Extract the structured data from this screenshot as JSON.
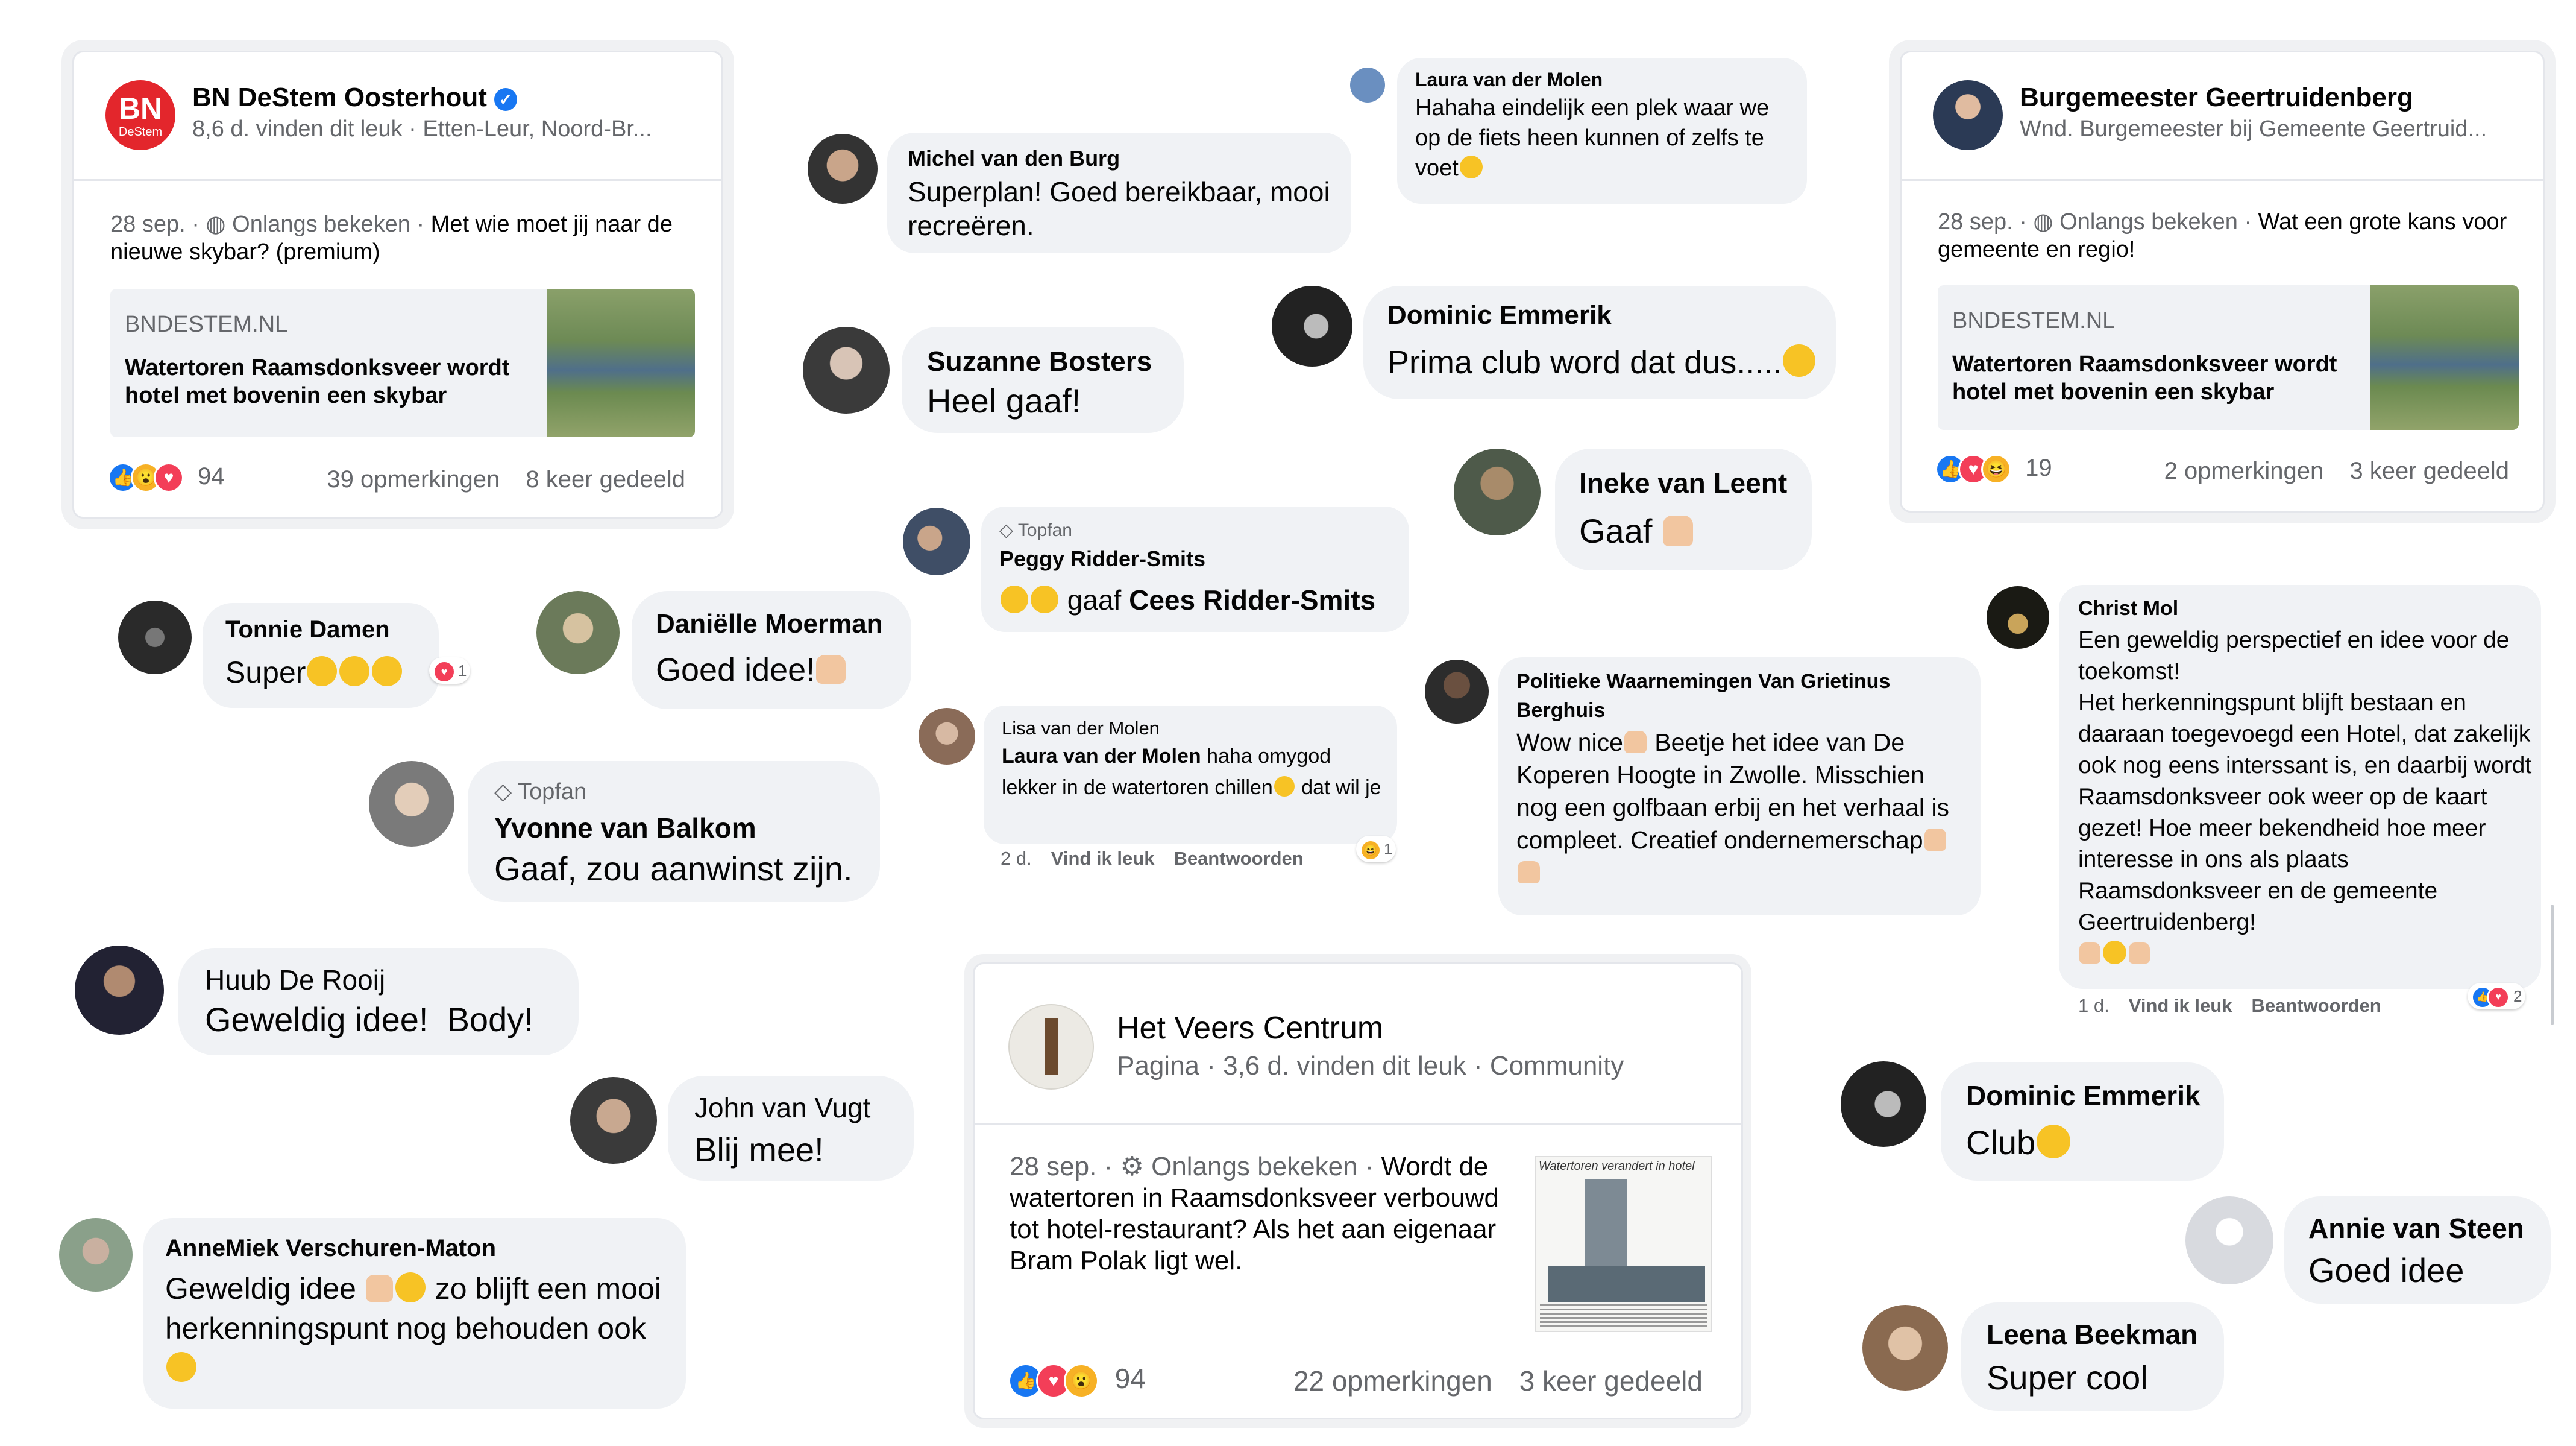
{
  "posts": {
    "bn": {
      "name": "BN DeStem Oosterhout",
      "logo_text": "BN",
      "logo_sub": "DeStem",
      "sub": "8,6 d. vinden dit leuk · Etten-Leur, Noord-Br...",
      "date": "28 sep. · ",
      "seen": "Onlangs bekeken · ",
      "text": "Met wie moet jij naar de nieuwe skybar? (premium)",
      "link_domain": "BNDESTEM.NL",
      "link_title": "Watertoren Raamsdonksveer wordt hotel met bovenin een skybar",
      "reactions": "94",
      "comments": "39 opmerkingen",
      "shares": "8 keer gedeeld"
    },
    "burgemeester": {
      "name": "Burgemeester Geertruidenberg",
      "sub": "Wnd. Burgemeester bij Gemeente Geertruid...",
      "date": "28 sep. · ",
      "seen": "Onlangs bekeken · ",
      "text": "Wat een grote kans voor gemeente en regio!",
      "link_domain": "BNDESTEM.NL",
      "link_title": "Watertoren Raamsdonksveer wordt hotel met bovenin een skybar",
      "reactions": "19",
      "comments": "2 opmerkingen",
      "shares": "3 keer gedeeld"
    },
    "veers": {
      "name": "Het Veers Centrum",
      "sub": "Pagina · 3,6 d. vinden dit leuk · Community",
      "date": "28 sep. · ",
      "seen": "Onlangs bekeken · ",
      "text": "Wordt de watertoren in Raamsdonksveer verbouwd tot hotel-restaurant? Als het aan eigenaar Bram Polak ligt wel.",
      "thumb_caption": "Watertoren verandert in hotel",
      "reactions": "94",
      "comments": "22 opmerkingen",
      "shares": "3 keer gedeeld"
    }
  },
  "comments": {
    "michel": {
      "name": "Michel van den Burg",
      "text": "Superplan! Goed bereikbaar, mooi recreëren."
    },
    "laura": {
      "name": "Laura van der Molen",
      "text": "Hahaha eindelijk een plek waar we op de fiets heen kunnen of zelfs te voet"
    },
    "suzanne": {
      "name": "Suzanne Bosters",
      "text": "Heel gaaf!"
    },
    "dominic1": {
      "name": "Dominic Emmerik",
      "text": "Prima club word dat dus....."
    },
    "ineke": {
      "name": "Ineke van Leent",
      "text": "Gaaf"
    },
    "peggy": {
      "badge": "Topfan",
      "name": "Peggy Ridder-Smits",
      "text": "gaaf",
      "mention": "Cees Ridder-Smits"
    },
    "tonnie": {
      "name": "Tonnie Damen",
      "text": "Super",
      "reaction_count": "1"
    },
    "danielle": {
      "name": "Daniëlle Moerman",
      "text": "Goed idee!"
    },
    "lisa": {
      "name": "Lisa van der Molen",
      "mention": "Laura van der Molen",
      "text": "haha omygod lekker in de watertoren chillen",
      "text2": "dat wil je",
      "time": "2 d.",
      "like": "Vind ik leuk",
      "reply": "Beantwoorden",
      "reaction_count": "1"
    },
    "politiek": {
      "name": "Politieke Waarnemingen Van Grietinus Berghuis",
      "text": "Wow nice",
      "text2": "Beetje het idee van De Koperen Hoogte in Zwolle. Misschien nog een golfbaan erbij en het verhaal is compleet. Creatief ondernemerschap"
    },
    "christ": {
      "name": "Christ Mol",
      "text": "Een geweldig perspectief en idee voor de toekomst!",
      "text2": "Het herkenningspunt blijft bestaan en daaraan toegevoegd een Hotel, dat zakelijk ook nog eens interssant is, en daarbij wordt Raamsdonksveer ook weer op de kaart gezet! Hoe meer bekendheid hoe meer interesse in ons als plaats Raamsdonksveer en de gemeente Geertruidenberg!",
      "time": "1 d.",
      "like": "Vind ik leuk",
      "reply": "Beantwoorden",
      "reaction_count": "2"
    },
    "yvonne": {
      "badge": "Topfan",
      "name": "Yvonne van Balkom",
      "text": "Gaaf, zou aanwinst zijn."
    },
    "huub": {
      "name": "Huub De Rooij",
      "text": "Geweldig idee!  Body!"
    },
    "john": {
      "name": "John van Vugt",
      "text": "Blij mee!"
    },
    "annemiek": {
      "name": "AnneMiek Verschuren-Maton",
      "text": "Geweldig idee",
      "text2": "zo blijft een mooi herkenningspunt nog behouden ook"
    },
    "dominic2": {
      "name": "Dominic Emmerik",
      "text": "Club"
    },
    "annie": {
      "name": "Annie van Steen",
      "text": "Goed idee"
    },
    "leena": {
      "name": "Leena Beekman",
      "text": "Super cool"
    }
  },
  "colors": {
    "like": "#1877f2",
    "love": "#f33e58",
    "bubble": "#f0f2f5",
    "muted": "#65676b",
    "brand_bn": "#e3262c"
  },
  "icons": [
    "verified-badge-icon",
    "globe-icon",
    "gear-icon",
    "like-reaction-icon",
    "love-reaction-icon",
    "wow-reaction-icon",
    "haha-reaction-icon",
    "diamond-icon",
    "thumbs-up-emoji",
    "smiley-emoji"
  ]
}
